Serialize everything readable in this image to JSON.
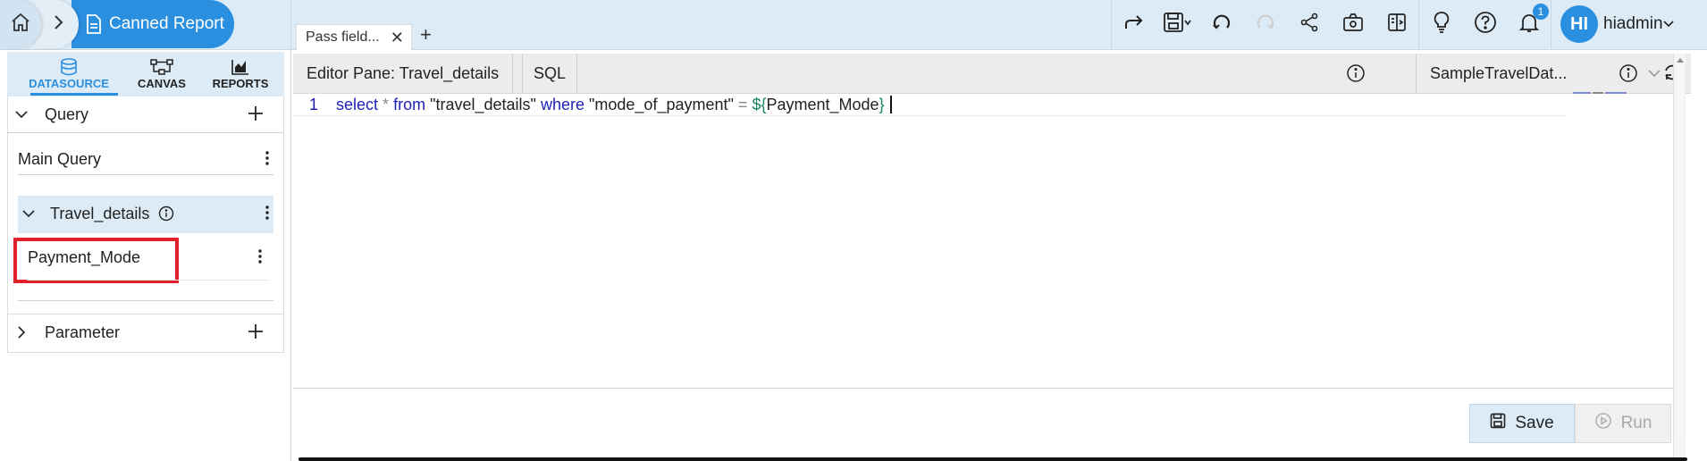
{
  "breadcrumb": {
    "report_label": "Canned Report"
  },
  "tabs": [
    {
      "label": "Pass field..."
    }
  ],
  "toolbar": {
    "notification_count": "1",
    "avatar_initials": "HI",
    "username": "hiadmin"
  },
  "sidebar": {
    "tabs": [
      {
        "label": "DATASOURCE"
      },
      {
        "label": "CANVAS"
      },
      {
        "label": "REPORTS"
      }
    ],
    "query_section": "Query",
    "main_query": "Main Query",
    "travel_details": "Travel_details",
    "payment_mode": "Payment_Mode",
    "parameter_section": "Parameter"
  },
  "editor": {
    "pane_title": "Editor Pane: Travel_details",
    "mode_label": "SQL",
    "datasource": "SampleTravelDat...",
    "line_number": "1",
    "tokens": {
      "select": "select",
      "star": "*",
      "from": "from",
      "table": "\"travel_details\"",
      "where": "where",
      "column": "\"mode_of_payment\"",
      "eq": "=",
      "dollar": "${",
      "param": "Payment_Mode",
      "close": "}"
    },
    "save_label": "Save",
    "run_label": "Run"
  },
  "colors": {
    "accent": "#2b8fe0",
    "highlight": "#dcebf6",
    "red_box": "#e0202a"
  }
}
